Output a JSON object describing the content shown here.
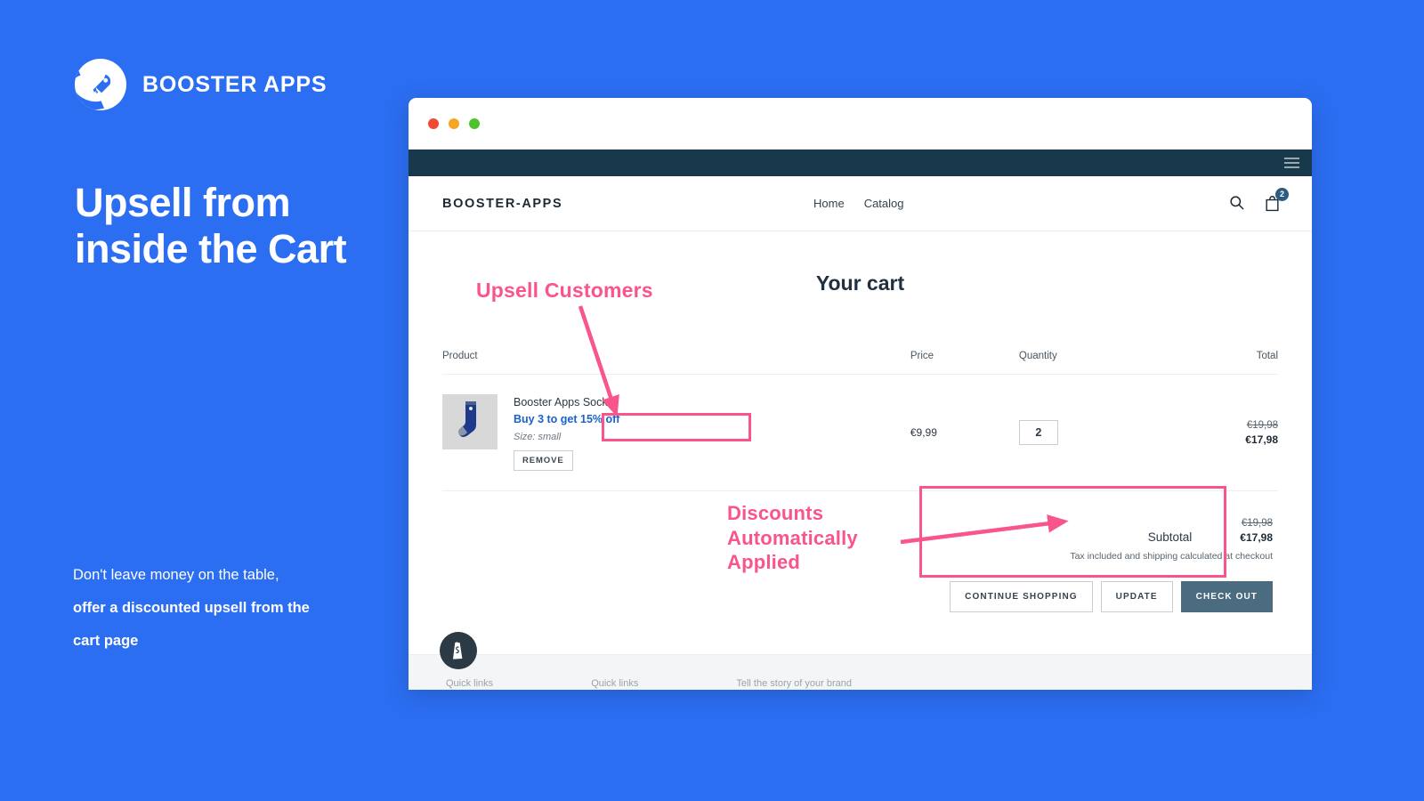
{
  "brand": {
    "name": "BOOSTER APPS",
    "logo_icon": "rocket-icon"
  },
  "hero": {
    "headline": "Upsell from inside the Cart",
    "subcopy_line1": "Don't leave money on the table,",
    "subcopy_line2": "offer a discounted upsell from the",
    "subcopy_line3": "cart page"
  },
  "browser": {
    "dots": [
      "close-dot",
      "minimize-dot",
      "maximize-dot"
    ],
    "menu_icon": "hamburger-icon"
  },
  "store_header": {
    "logo": "BOOSTER-APPS",
    "nav": [
      {
        "label": "Home"
      },
      {
        "label": "Catalog"
      }
    ],
    "search_icon": "search-icon",
    "cart_icon": "shopping-bag-icon",
    "cart_count": "2"
  },
  "cart": {
    "title": "Your cart",
    "columns": {
      "product": "Product",
      "price": "Price",
      "quantity": "Quantity",
      "total": "Total"
    },
    "items": [
      {
        "name": "Booster Apps Socks",
        "promo": "Buy 3 to get 15% off",
        "variant": "Size: small",
        "remove_label": "REMOVE",
        "price": "€9,99",
        "quantity": "2",
        "total_old": "€19,98",
        "total_new": "€17,98",
        "thumb_icon": "sock-image"
      }
    ],
    "subtotal": {
      "label": "Subtotal",
      "old": "€19,98",
      "new": "€17,98",
      "note": "Tax included and shipping calculated at checkout"
    },
    "actions": {
      "continue": "CONTINUE SHOPPING",
      "update": "UPDATE",
      "checkout": "CHECK OUT"
    }
  },
  "footer": {
    "col1": "Quick links",
    "col2": "Quick links",
    "col3": "Tell the story of your brand"
  },
  "badges": {
    "shopify_icon": "shopify-bag-icon"
  },
  "annotations": {
    "upsell": "Upsell Customers",
    "discount_line1": "Discounts",
    "discount_line2": "Automatically",
    "discount_line3": "Applied"
  },
  "colors": {
    "background_blue": "#2c6ef2",
    "annotation_pink": "#f9548c",
    "promo_blue": "#1a62c9",
    "dark_nav": "#17394b",
    "checkout_button": "#4a6b80",
    "cart_badge": "#2e5b7f"
  }
}
